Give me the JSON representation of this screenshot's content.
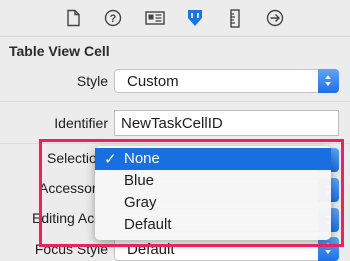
{
  "toolbar": {
    "icons": [
      "file-inspector-icon",
      "quick-help-icon",
      "identity-inspector-icon",
      "attributes-inspector-icon",
      "size-inspector-icon",
      "connections-inspector-icon"
    ],
    "active": "attributes-inspector-icon",
    "accent": "#1a73e8"
  },
  "section": {
    "title": "Table View Cell"
  },
  "style": {
    "label": "Style",
    "value": "Custom"
  },
  "identifier": {
    "label": "Identifier",
    "value": "NewTaskCellID"
  },
  "selection": {
    "label": "Selection"
  },
  "accessory": {
    "label": "Accessory"
  },
  "editing_accessory": {
    "label": "Editing Accessory"
  },
  "focus_style": {
    "label": "Focus Style",
    "value": "Default"
  },
  "menu": {
    "check": "✓",
    "items": [
      {
        "label": "None",
        "selected": true
      },
      {
        "label": "Blue",
        "selected": false
      },
      {
        "label": "Gray",
        "selected": false
      },
      {
        "label": "Default",
        "selected": false
      }
    ],
    "selected_color": "#1a6fe0"
  },
  "highlight_color": "#e8245e"
}
